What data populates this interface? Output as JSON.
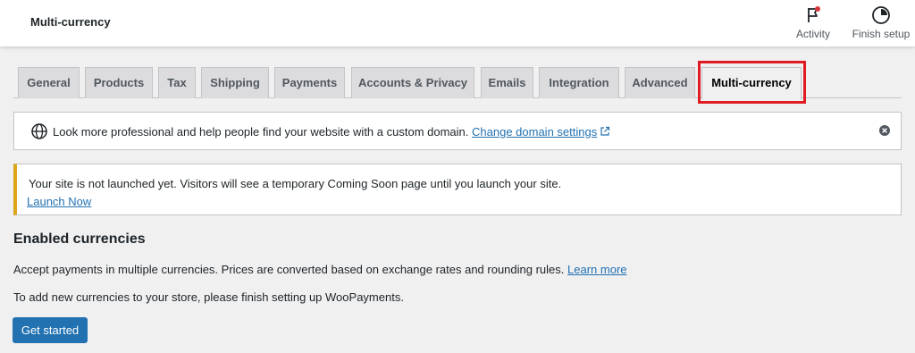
{
  "header": {
    "title": "Multi-currency",
    "actions": [
      {
        "label": "Activity",
        "icon": "flag-icon",
        "has_notification": true,
        "notification_color": "#d63638"
      },
      {
        "label": "Finish setup",
        "icon": "progress-circle-icon"
      }
    ]
  },
  "tabs": [
    {
      "label": "General",
      "active": false
    },
    {
      "label": "Products",
      "active": false
    },
    {
      "label": "Tax",
      "active": false
    },
    {
      "label": "Shipping",
      "active": false
    },
    {
      "label": "Payments",
      "active": false
    },
    {
      "label": "Accounts & Privacy",
      "active": false
    },
    {
      "label": "Emails",
      "active": false
    },
    {
      "label": "Integration",
      "active": false
    },
    {
      "label": "Advanced",
      "active": false
    },
    {
      "label": "Multi-currency",
      "active": true
    }
  ],
  "domain_notice": {
    "icon": "globe-icon",
    "text": "Look more professional and help people find your website with a custom domain.",
    "link_label": "Change domain settings",
    "link_icon": "external-link-icon",
    "dismiss_icon": "close-circle-icon"
  },
  "launch_notice": {
    "text": "Your site is not launched yet. Visitors will see a temporary Coming Soon page until you launch your site.",
    "link_label": "Launch Now",
    "accent_color": "#dba617"
  },
  "section": {
    "title": "Enabled currencies",
    "description": "Accept payments in multiple currencies. Prices are converted based on exchange rates and rounding rules.",
    "learn_more_label": "Learn more",
    "note": "To add new currencies to your store, please finish setting up WooPayments.",
    "button_label": "Get started"
  },
  "colors": {
    "primary": "#2271b1",
    "highlight": "#e01b24",
    "background": "#f0f0f1"
  }
}
